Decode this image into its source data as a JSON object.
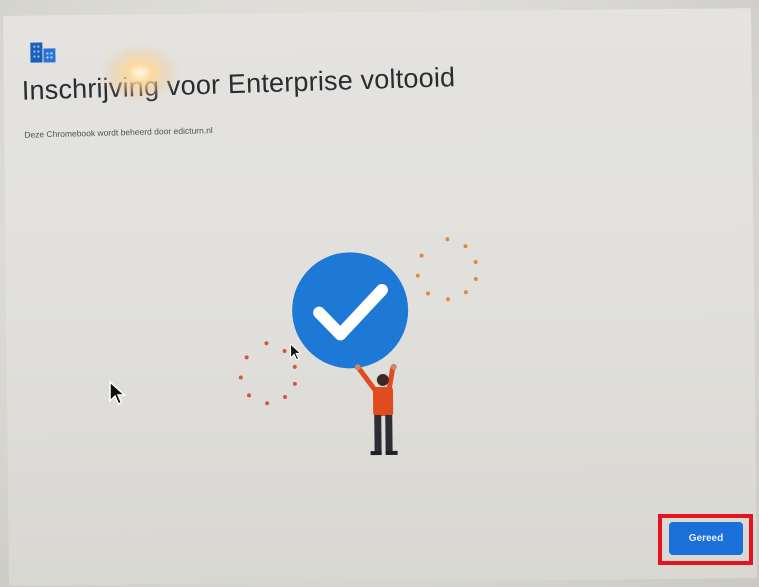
{
  "header": {
    "logo_icon": "enterprise-building-icon",
    "title": "Inschrijving voor Enterprise voltooid",
    "subtitle": "Deze Chromebook wordt beheerd door edicturn.nl"
  },
  "illustration": {
    "icon": "checkmark-circle-icon",
    "figure": "person-holding-checkmark"
  },
  "footer": {
    "done_label": "Gereed"
  },
  "colors": {
    "accent": "#1a73e8",
    "check_circle": "#1e78d6",
    "highlight": "#e3141e",
    "confetti": "#e08a3a"
  }
}
